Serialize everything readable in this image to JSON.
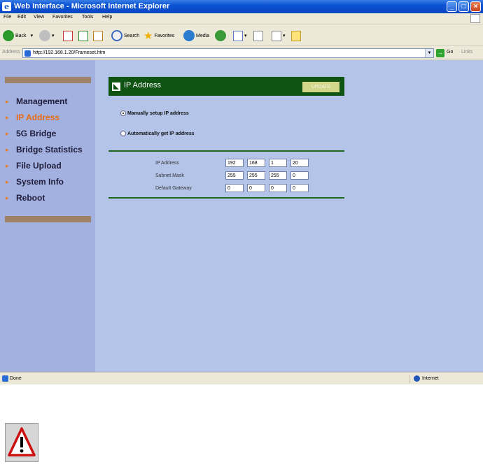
{
  "window": {
    "title": "Web Interface - Microsoft Internet Explorer"
  },
  "menu": [
    "File",
    "Edit",
    "View",
    "Favorites",
    "Tools",
    "Help"
  ],
  "toolbar": {
    "back": "Back",
    "search": "Search",
    "favorites": "Favorites",
    "media": "Media"
  },
  "address": {
    "label": "Address",
    "url": "http://192.168.1.20/Frameset.htm",
    "go": "Go",
    "links": "Links"
  },
  "sidebar": {
    "items": [
      {
        "label": "Management",
        "active": false
      },
      {
        "label": "IP Address",
        "active": true
      },
      {
        "label": "5G Bridge",
        "active": false
      },
      {
        "label": "Bridge Statistics",
        "active": false
      },
      {
        "label": "File Upload",
        "active": false
      },
      {
        "label": "System Info",
        "active": false
      },
      {
        "label": "Reboot",
        "active": false
      }
    ]
  },
  "panel": {
    "title": "IP Address",
    "update_label": "UPDATE",
    "radio_manual": "Manually setup IP address",
    "radio_auto": "Automatically get IP address",
    "fields": [
      {
        "label": "IP Address",
        "values": [
          "192",
          "168",
          "1",
          "20"
        ]
      },
      {
        "label": "Subnet Mask",
        "values": [
          "255",
          "255",
          "255",
          "0"
        ]
      },
      {
        "label": "Default Gateway",
        "values": [
          "0",
          "0",
          "0",
          "0"
        ]
      }
    ]
  },
  "status": {
    "text": "Done",
    "zone": "Internet"
  },
  "colors": {
    "header_bg": "#0f5412",
    "sidebar_bg": "#a3b1e0",
    "content_bg": "#b3c4e8",
    "active_nav": "#ea6a10",
    "divider": "#1d6a1d"
  }
}
